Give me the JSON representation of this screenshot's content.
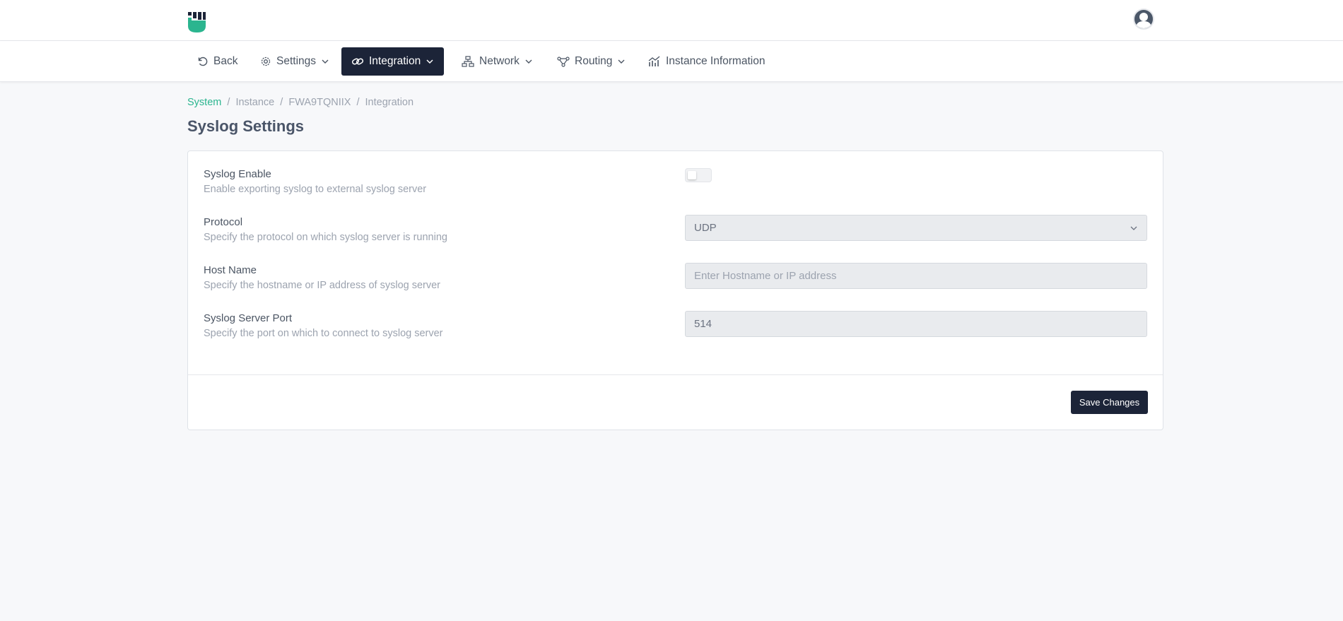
{
  "header": {
    "logo_icon": "fist-logo-icon",
    "avatar_icon": "user-avatar-icon",
    "brand_color": "#2bb58f"
  },
  "nav": {
    "back": "Back",
    "settings": "Settings",
    "integration": "Integration",
    "network": "Network",
    "routing": "Routing",
    "instance_information": "Instance Information",
    "active_item": "Integration",
    "active_bg": "#1c2438"
  },
  "breadcrumb": {
    "system": "System",
    "instance": "Instance",
    "instance_id": "FWA9TQNIIX",
    "integration": "Integration",
    "separator": "/"
  },
  "page": {
    "title": "Syslog Settings"
  },
  "form": {
    "syslog_enable": {
      "label": "Syslog Enable",
      "description": "Enable exporting syslog to external syslog server",
      "enabled": false
    },
    "protocol": {
      "label": "Protocol",
      "description": "Specify the protocol on which syslog server is running",
      "value": "UDP"
    },
    "host_name": {
      "label": "Host Name",
      "description": "Specify the hostname or IP address of syslog server",
      "placeholder": "Enter Hostname or IP address",
      "value": ""
    },
    "port": {
      "label": "Syslog Server Port",
      "description": "Specify the port on which to connect to syslog server",
      "value": "514"
    }
  },
  "footer": {
    "save_label": "Save Changes"
  }
}
